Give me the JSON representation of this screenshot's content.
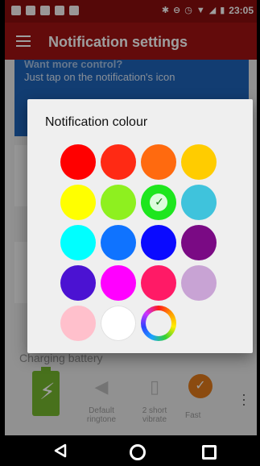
{
  "statusbar": {
    "time": "23:05"
  },
  "appbar": {
    "title": "Notification settings"
  },
  "background": {
    "card_line1": "Want more control?",
    "card_line2": "Just tap on the notification's icon",
    "section_title": "Charging battery",
    "actions": [
      {
        "label1": "Default",
        "label2": "ringtone",
        "icon": "speaker-icon"
      },
      {
        "label1": "2 short",
        "label2": "vibrate",
        "icon": "vibrate-icon"
      }
    ],
    "fast_label": "Fast"
  },
  "dialog": {
    "title": "Notification colour",
    "swatches": [
      {
        "color": "#ff0000"
      },
      {
        "color": "#ff2a14"
      },
      {
        "color": "#ff6a0f"
      },
      {
        "color": "#ffcc00"
      },
      {
        "color": "#ffff00"
      },
      {
        "color": "#8ef01f"
      },
      {
        "color": "#1ee61e",
        "selected": true
      },
      {
        "color": "#3fc3dc"
      },
      {
        "color": "#00ffff"
      },
      {
        "color": "#0f73ff"
      },
      {
        "color": "#0a0aff"
      },
      {
        "color": "#7a0a84"
      },
      {
        "color": "#4b12d2"
      },
      {
        "color": "#ff00ff"
      },
      {
        "color": "#ff1a66"
      },
      {
        "color": "#c8a3d4"
      },
      {
        "color": "#ffc0cc"
      },
      {
        "color": "#ffffff"
      },
      {
        "color": "custom",
        "custom": true
      }
    ]
  }
}
